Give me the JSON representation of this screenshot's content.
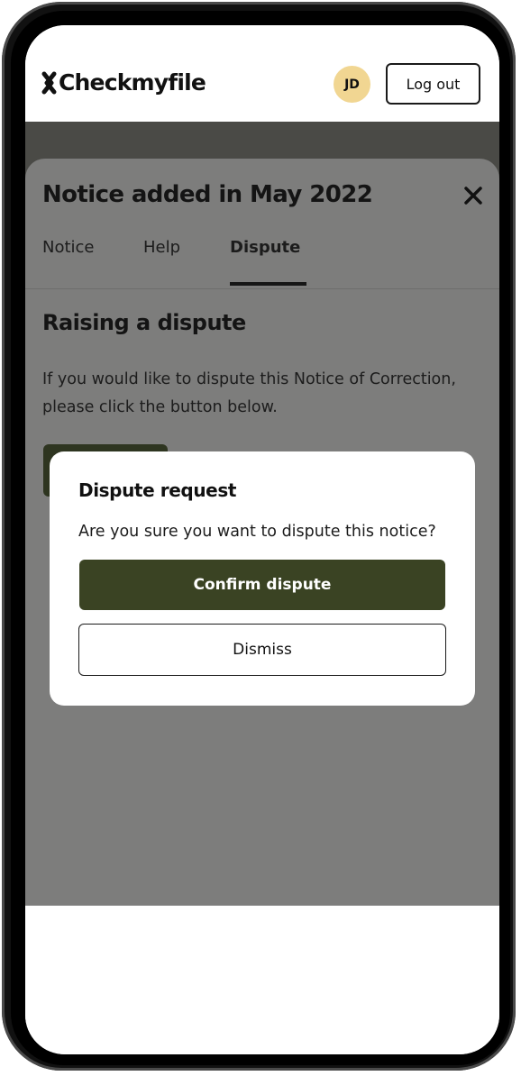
{
  "header": {
    "logo_text": "Checkmyfile",
    "avatar_initials": "JD",
    "logout_label": "Log out",
    "avatar_color": "#f1d692"
  },
  "sheet": {
    "title": "Notice added in May 2022",
    "close_icon": "close-icon",
    "tabs": [
      {
        "label": "Notice",
        "active": false
      },
      {
        "label": "Help",
        "active": false
      },
      {
        "label": "Dispute",
        "active": true
      }
    ],
    "section_heading": "Raising a dispute",
    "section_body": "If you would like to dispute this Notice of Correction, please click the button below."
  },
  "modal": {
    "title": "Dispute request",
    "message": "Are you sure you want to dispute this notice?",
    "confirm_label": "Confirm dispute",
    "dismiss_label": "Dismiss",
    "confirm_color": "#3a4323",
    "close_icon": "close-icon"
  }
}
